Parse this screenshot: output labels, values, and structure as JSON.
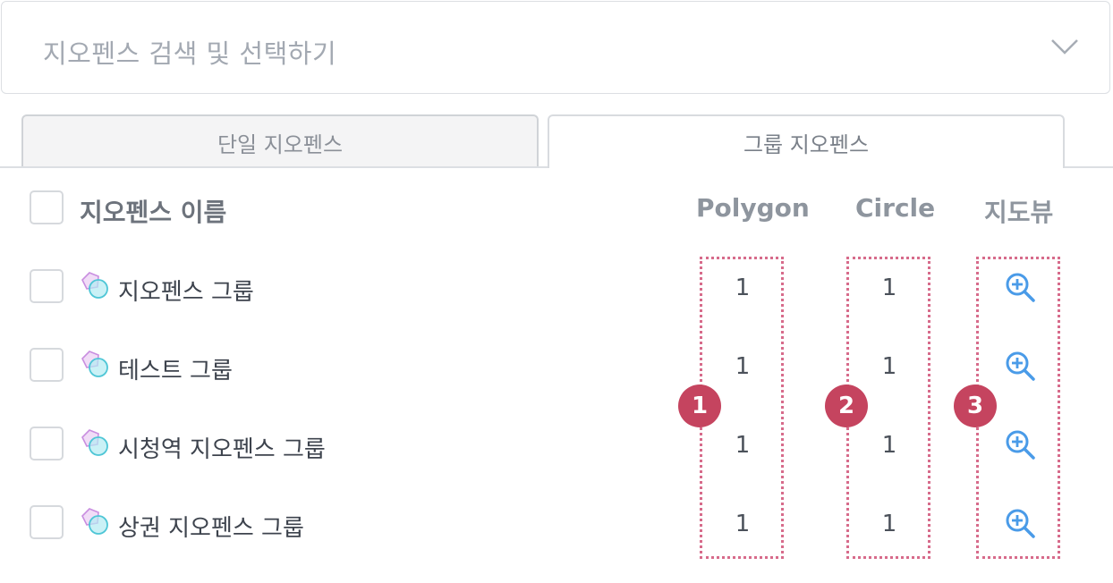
{
  "search": {
    "placeholder": "지오펜스 검색 및 선택하기"
  },
  "tabs": [
    {
      "label": "단일 지오펜스"
    },
    {
      "label": "그룹 지오펜스"
    }
  ],
  "table": {
    "headers": {
      "name": "지오펜스 이름",
      "polygon": "Polygon",
      "circle": "Circle",
      "map_view": "지도뷰"
    },
    "rows": [
      {
        "name": "지오펜스 그룹",
        "polygon": "1",
        "circle": "1"
      },
      {
        "name": "테스트 그룹",
        "polygon": "1",
        "circle": "1"
      },
      {
        "name": "시청역 지오펜스 그룹",
        "polygon": "1",
        "circle": "1"
      },
      {
        "name": "상권 지오펜스 그룹",
        "polygon": "1",
        "circle": "1"
      }
    ]
  },
  "annotations": [
    {
      "label": "1"
    },
    {
      "label": "2"
    },
    {
      "label": "3"
    }
  ],
  "colors": {
    "accent": "#4a9be8",
    "annotation": "#c5445f",
    "annotation_border": "#d76b8b"
  },
  "icons": {
    "dropdown": "chevron-down-icon",
    "row": "polygon-circle-group-icon",
    "map_view": "zoom-in-icon"
  }
}
